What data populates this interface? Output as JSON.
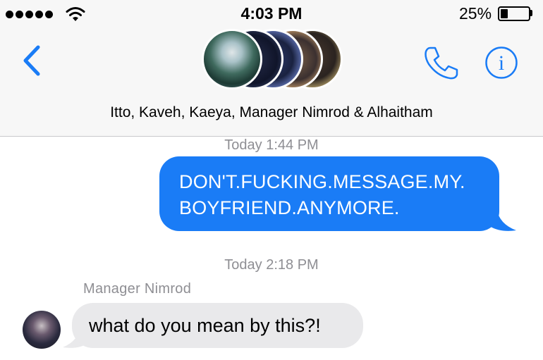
{
  "status_bar": {
    "time": "4:03 PM",
    "battery_percent": "25%",
    "battery_level": 0.25,
    "signal_dots": 5
  },
  "nav": {
    "back_icon": "chevron-left-icon",
    "phone_icon": "phone-icon",
    "info_icon": "info-icon",
    "info_glyph": "i",
    "accent_color": "#1a7cf6"
  },
  "conversation": {
    "participants": "Itto, Kaveh, Kaeya, Manager Nimrod & Alhaitham"
  },
  "messages": [
    {
      "timestamp": "Today 1:44 PM",
      "direction": "outgoing",
      "text": "DON'T.FUCKING.MESSAGE.MY.\nBOYFRIEND.ANYMORE.",
      "line1": "DON'T.FUCKING.MESSAGE.MY.",
      "line2": "BOYFRIEND.ANYMORE."
    },
    {
      "timestamp": "Today 2:18 PM",
      "direction": "incoming",
      "sender": "Manager Nimrod",
      "text": "what do you mean by this?!"
    }
  ],
  "colors": {
    "outgoing_bubble": "#1a7cf6",
    "incoming_bubble": "#e9e9eb",
    "meta_text": "#8e8e93"
  }
}
